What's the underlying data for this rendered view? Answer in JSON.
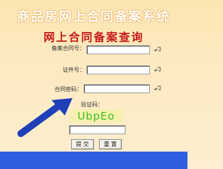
{
  "header": {
    "title": "商品房网上合同备案系统",
    "subtitle": "网上合同备案查询"
  },
  "form": {
    "contract_no_label": "备案合同号：",
    "contract_no_value": "",
    "id_no_label": "证件号：",
    "id_no_value": "",
    "password_label": "合同密码：",
    "password_value": "",
    "captcha_label": "验证码：",
    "captcha_text": "UbpEo",
    "captcha_input_value": ""
  },
  "buttons": {
    "submit_label": "提 交",
    "reset_label": "重 置"
  },
  "colors": {
    "title_glow": "#e6a33a",
    "subtitle": "#c81818",
    "arrow": "#1f3fb8",
    "captcha_text": "#3fbf1a",
    "bottom_bar": "#2f5fe0"
  },
  "icons": [
    "edit-icon",
    "arrow-annotation"
  ]
}
